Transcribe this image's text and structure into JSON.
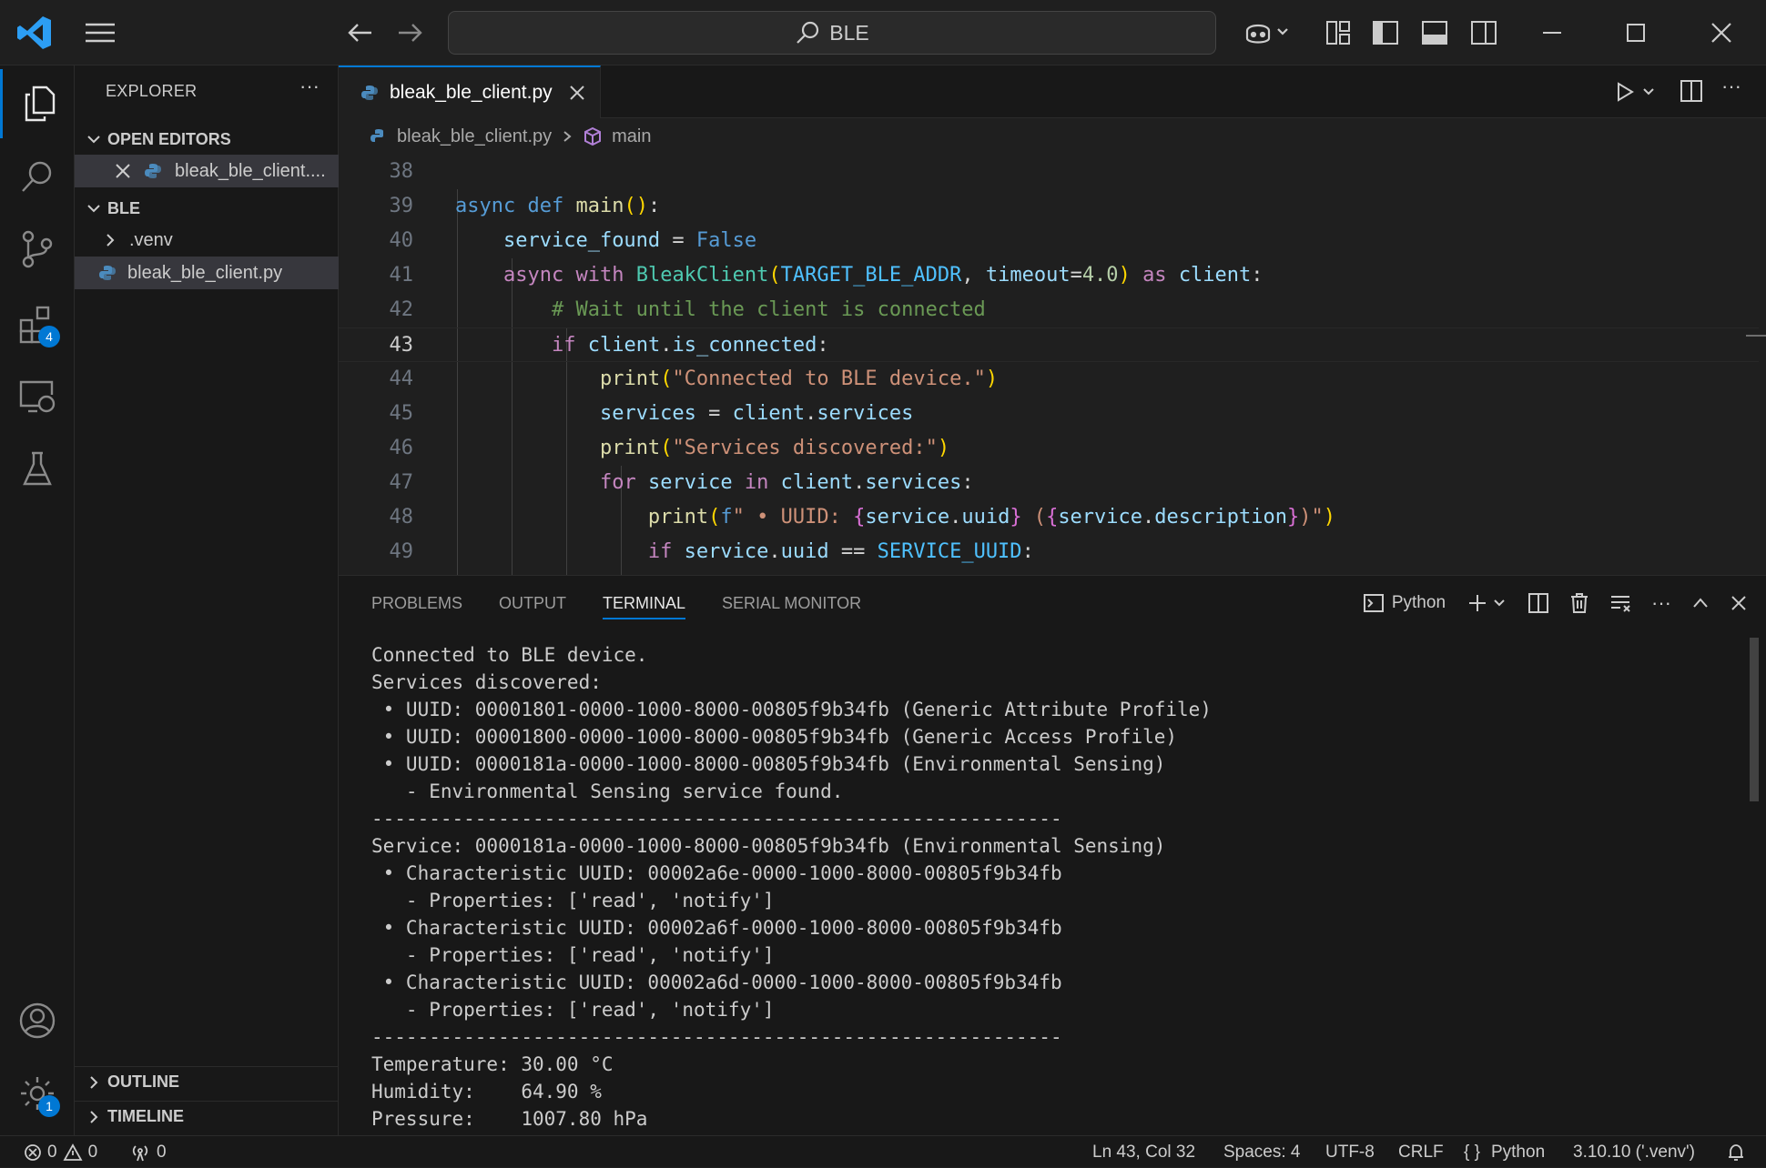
{
  "titlebar": {
    "search_text": "BLE"
  },
  "activity_bar": {
    "extensions_badge": "4",
    "settings_badge": "1"
  },
  "sidebar": {
    "title": "EXPLORER",
    "more": "···",
    "open_editors_label": "OPEN EDITORS",
    "open_editor_item": "bleak_ble_client....",
    "folder_label": "BLE",
    "tree": [
      ".venv",
      "bleak_ble_client.py"
    ],
    "outline_label": "OUTLINE",
    "timeline_label": "TIMELINE"
  },
  "editor": {
    "tab_label": "bleak_ble_client.py",
    "breadcrumb_file": "bleak_ble_client.py",
    "breadcrumb_symbol": "main",
    "current_line": 43,
    "lines": [
      {
        "n": "38",
        "tokens": []
      },
      {
        "n": "39",
        "tokens": [
          [
            "kw",
            "async"
          ],
          [
            "op",
            " "
          ],
          [
            "kw",
            "def"
          ],
          [
            "op",
            " "
          ],
          [
            "fn",
            "main"
          ],
          [
            "p1",
            "()"
          ],
          [
            "op",
            ":"
          ]
        ]
      },
      {
        "n": "40",
        "tokens": [
          [
            "op",
            "    "
          ],
          [
            "var",
            "service_found"
          ],
          [
            "op",
            " = "
          ],
          [
            "kw",
            "False"
          ]
        ]
      },
      {
        "n": "41",
        "tokens": [
          [
            "op",
            "    "
          ],
          [
            "kw2",
            "async"
          ],
          [
            "op",
            " "
          ],
          [
            "kw2",
            "with"
          ],
          [
            "op",
            " "
          ],
          [
            "cls",
            "BleakClient"
          ],
          [
            "p1",
            "("
          ],
          [
            "const",
            "TARGET_BLE_ADDR"
          ],
          [
            "op",
            ", "
          ],
          [
            "var",
            "timeout"
          ],
          [
            "op",
            "="
          ],
          [
            "num",
            "4.0"
          ],
          [
            "p1",
            ")"
          ],
          [
            "op",
            " "
          ],
          [
            "kw2",
            "as"
          ],
          [
            "op",
            " "
          ],
          [
            "var",
            "client"
          ],
          [
            "op",
            ":"
          ]
        ]
      },
      {
        "n": "42",
        "tokens": [
          [
            "op",
            "        "
          ],
          [
            "cm",
            "# Wait until the client is connected"
          ]
        ]
      },
      {
        "n": "43",
        "tokens": [
          [
            "op",
            "        "
          ],
          [
            "kw2",
            "if"
          ],
          [
            "op",
            " "
          ],
          [
            "var",
            "client"
          ],
          [
            "op",
            "."
          ],
          [
            "var",
            "is_connected"
          ],
          [
            "op",
            ":"
          ]
        ]
      },
      {
        "n": "44",
        "tokens": [
          [
            "op",
            "            "
          ],
          [
            "fn",
            "print"
          ],
          [
            "p1",
            "("
          ],
          [
            "str",
            "\"Connected to BLE device.\""
          ],
          [
            "p1",
            ")"
          ]
        ]
      },
      {
        "n": "45",
        "tokens": [
          [
            "op",
            "            "
          ],
          [
            "var",
            "services"
          ],
          [
            "op",
            " = "
          ],
          [
            "var",
            "client"
          ],
          [
            "op",
            "."
          ],
          [
            "var",
            "services"
          ]
        ]
      },
      {
        "n": "46",
        "tokens": [
          [
            "op",
            "            "
          ],
          [
            "fn",
            "print"
          ],
          [
            "p1",
            "("
          ],
          [
            "str",
            "\"Services discovered:\""
          ],
          [
            "p1",
            ")"
          ]
        ]
      },
      {
        "n": "47",
        "tokens": [
          [
            "op",
            "            "
          ],
          [
            "kw2",
            "for"
          ],
          [
            "op",
            " "
          ],
          [
            "var",
            "service"
          ],
          [
            "op",
            " "
          ],
          [
            "kw2",
            "in"
          ],
          [
            "op",
            " "
          ],
          [
            "var",
            "client"
          ],
          [
            "op",
            "."
          ],
          [
            "var",
            "services"
          ],
          [
            "op",
            ":"
          ]
        ]
      },
      {
        "n": "48",
        "tokens": [
          [
            "op",
            "                "
          ],
          [
            "fn",
            "print"
          ],
          [
            "p1",
            "("
          ],
          [
            "kw",
            "f"
          ],
          [
            "str",
            "\" • UUID: "
          ],
          [
            "p2",
            "{"
          ],
          [
            "var",
            "service"
          ],
          [
            "op",
            "."
          ],
          [
            "var",
            "uuid"
          ],
          [
            "p2",
            "}"
          ],
          [
            "str",
            " ("
          ],
          [
            "p2",
            "{"
          ],
          [
            "var",
            "service"
          ],
          [
            "op",
            "."
          ],
          [
            "var",
            "description"
          ],
          [
            "p2",
            "}"
          ],
          [
            "str",
            ")\""
          ],
          [
            "p1",
            ")"
          ]
        ]
      },
      {
        "n": "49",
        "tokens": [
          [
            "op",
            "                "
          ],
          [
            "kw2",
            "if"
          ],
          [
            "op",
            " "
          ],
          [
            "var",
            "service"
          ],
          [
            "op",
            "."
          ],
          [
            "var",
            "uuid"
          ],
          [
            "op",
            " == "
          ],
          [
            "const",
            "SERVICE_UUID"
          ],
          [
            "op",
            ":"
          ]
        ]
      }
    ]
  },
  "panel": {
    "tabs": [
      "PROBLEMS",
      "OUTPUT",
      "TERMINAL",
      "SERIAL MONITOR"
    ],
    "active_tab": "TERMINAL",
    "shell_label": "Python",
    "terminal_lines": [
      "Connected to BLE device.",
      "Services discovered:",
      " • UUID: 00001801-0000-1000-8000-00805f9b34fb (Generic Attribute Profile)",
      " • UUID: 00001800-0000-1000-8000-00805f9b34fb (Generic Access Profile)",
      " • UUID: 0000181a-0000-1000-8000-00805f9b34fb (Environmental Sensing)",
      "   - Environmental Sensing service found.",
      "------------------------------------------------------------",
      "Service: 0000181a-0000-1000-8000-00805f9b34fb (Environmental Sensing)",
      " • Characteristic UUID: 00002a6e-0000-1000-8000-00805f9b34fb",
      "   - Properties: ['read', 'notify']",
      " • Characteristic UUID: 00002a6f-0000-1000-8000-00805f9b34fb",
      "   - Properties: ['read', 'notify']",
      " • Characteristic UUID: 00002a6d-0000-1000-8000-00805f9b34fb",
      "   - Properties: ['read', 'notify']",
      "------------------------------------------------------------",
      "Temperature: 30.00 °C",
      "Humidity:    64.90 %",
      "Pressure:    1007.80 hPa"
    ]
  },
  "statusbar": {
    "errors": "0",
    "warnings": "0",
    "ports": "0",
    "cursor": "Ln 43, Col 32",
    "spaces": "Spaces: 4",
    "encoding": "UTF-8",
    "eol": "CRLF",
    "language": "Python",
    "interpreter": "3.10.10 ('.venv')"
  },
  "colors": {
    "accent": "#0078d4",
    "background": "#1f1f1f",
    "sidebar": "#181818"
  }
}
